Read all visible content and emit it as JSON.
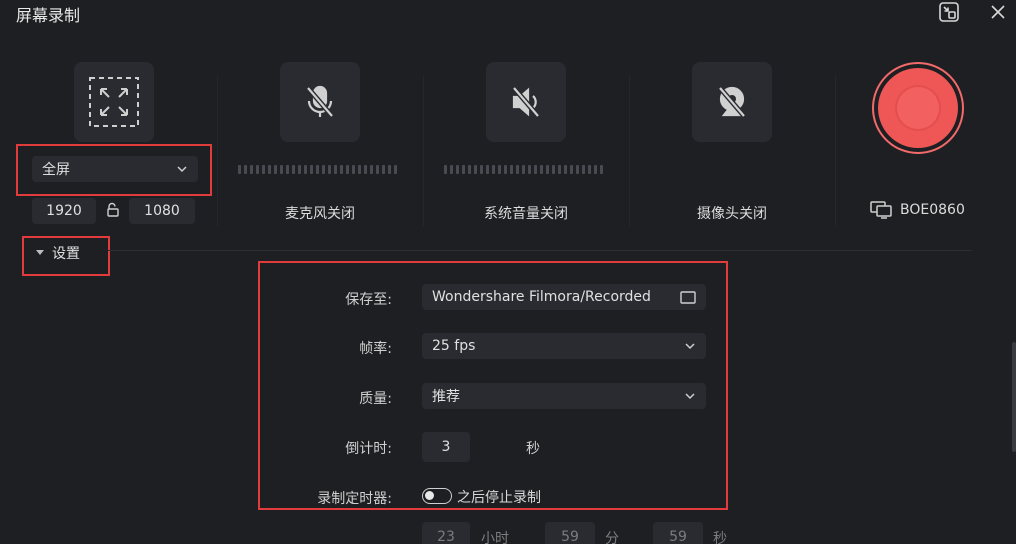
{
  "window": {
    "title": "屏幕录制"
  },
  "capture": {
    "mode": "全屏",
    "width": "1920",
    "height": "1080"
  },
  "devices": {
    "mic_label": "麦克风关闭",
    "system_audio_label": "系统音量关闭",
    "camera_label": "摄像头关闭",
    "monitor_label": "BOE0860"
  },
  "settings": {
    "header": "设置",
    "save_label": "保存至:",
    "save_path": "Wondershare Filmora/Recorded",
    "framerate_label": "帧率:",
    "framerate_value": "25 fps",
    "quality_label": "质量:",
    "quality_value": "推荐",
    "countdown_label": "倒计时:",
    "countdown_value": "3",
    "countdown_unit": "秒",
    "timer_label": "录制定时器:",
    "timer_toggle_text": "之后停止录制",
    "hours": "23",
    "hours_unit": "小时",
    "minutes": "59",
    "minutes_unit": "分",
    "seconds": "59",
    "seconds_unit": "秒"
  },
  "colors": {
    "background": "#1e1f23",
    "tile": "#2a2b31",
    "record": "#ef5656",
    "highlight": "#e23b3b"
  }
}
